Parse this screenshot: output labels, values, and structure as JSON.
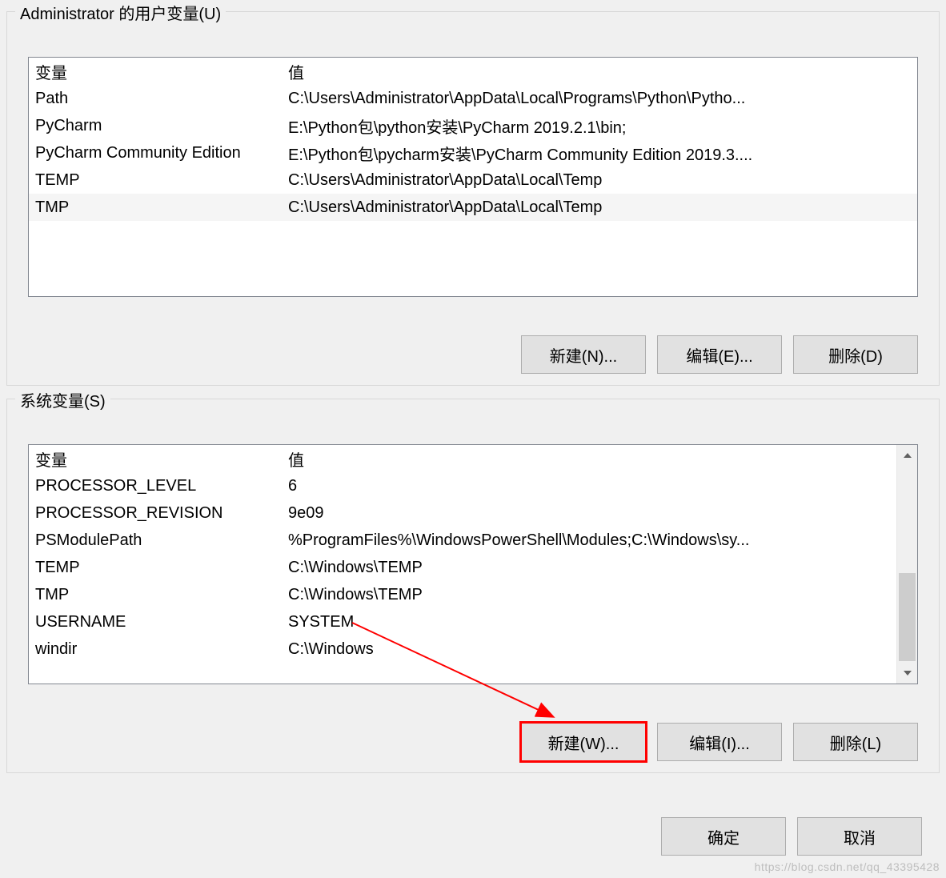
{
  "user_vars": {
    "title": "Administrator 的用户变量(U)",
    "columns": {
      "name": "变量",
      "value": "值"
    },
    "rows": [
      {
        "name": "Path",
        "value": "C:\\Users\\Administrator\\AppData\\Local\\Programs\\Python\\Pytho..."
      },
      {
        "name": "PyCharm",
        "value": "E:\\Python包\\python安装\\PyCharm 2019.2.1\\bin;"
      },
      {
        "name": "PyCharm Community Edition",
        "value": "E:\\Python包\\pycharm安装\\PyCharm Community Edition 2019.3...."
      },
      {
        "name": "TEMP",
        "value": "C:\\Users\\Administrator\\AppData\\Local\\Temp"
      },
      {
        "name": "TMP",
        "value": "C:\\Users\\Administrator\\AppData\\Local\\Temp"
      }
    ],
    "buttons": {
      "new": "新建(N)...",
      "edit": "编辑(E)...",
      "delete": "删除(D)"
    }
  },
  "system_vars": {
    "title": "系统变量(S)",
    "columns": {
      "name": "变量",
      "value": "值"
    },
    "rows": [
      {
        "name": "PROCESSOR_LEVEL",
        "value": "6"
      },
      {
        "name": "PROCESSOR_REVISION",
        "value": "9e09"
      },
      {
        "name": "PSModulePath",
        "value": "%ProgramFiles%\\WindowsPowerShell\\Modules;C:\\Windows\\sy..."
      },
      {
        "name": "TEMP",
        "value": "C:\\Windows\\TEMP"
      },
      {
        "name": "TMP",
        "value": "C:\\Windows\\TEMP"
      },
      {
        "name": "USERNAME",
        "value": "SYSTEM"
      },
      {
        "name": "windir",
        "value": "C:\\Windows"
      }
    ],
    "buttons": {
      "new": "新建(W)...",
      "edit": "编辑(I)...",
      "delete": "删除(L)"
    }
  },
  "dialog": {
    "ok": "确定",
    "cancel": "取消"
  },
  "watermark": "https://blog.csdn.net/qq_43395428"
}
